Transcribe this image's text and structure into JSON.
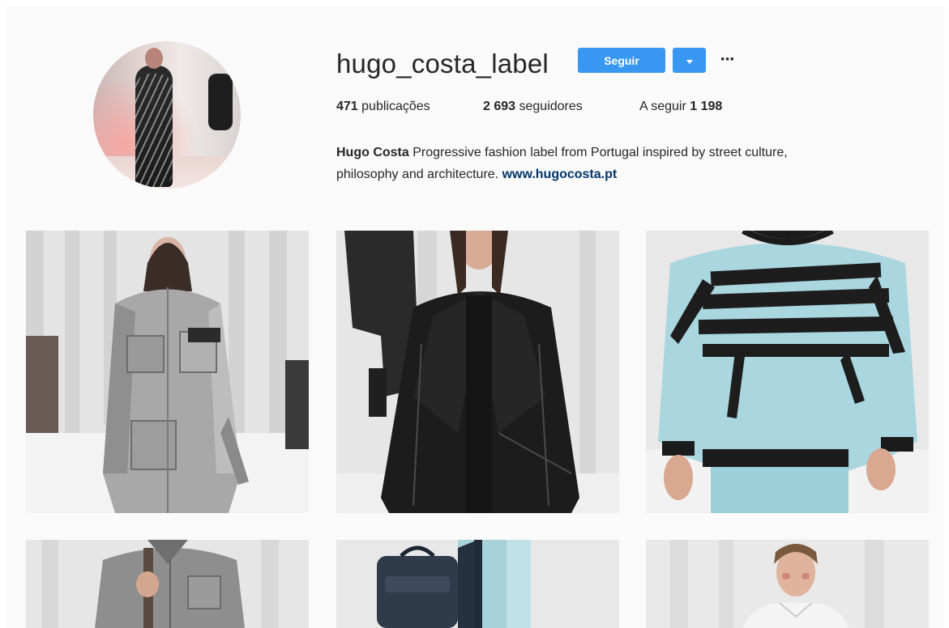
{
  "profile": {
    "username": "hugo_costa_label",
    "follow_label": "Seguir",
    "dropdown_icon": "chevron-down-icon",
    "more_label": "···",
    "stats": {
      "posts_count": "471",
      "posts_label": "publicações",
      "followers_count": "2 693",
      "followers_label": "seguidores",
      "following_label": "A seguir",
      "following_count": "1 198"
    },
    "bio": {
      "name": "Hugo Costa",
      "text_line1": "Progressive fashion label from Portugal inspired by street culture,",
      "text_line2": "philosophy and architecture.",
      "link": "www.hugocosta.pt"
    }
  },
  "posts": [
    {
      "look": "silver oversized parka with cargo pockets"
    },
    {
      "look": "black oversized coat"
    },
    {
      "look": "light blue sweatshirt with black straps"
    },
    {
      "look": "grey shirt jacket"
    },
    {
      "look": "navy backpack over light blue jacket"
    },
    {
      "look": "white jacket"
    }
  ],
  "colors": {
    "accent": "#3897f0",
    "link": "#003569",
    "background": "#fafafa",
    "text": "#262626"
  }
}
